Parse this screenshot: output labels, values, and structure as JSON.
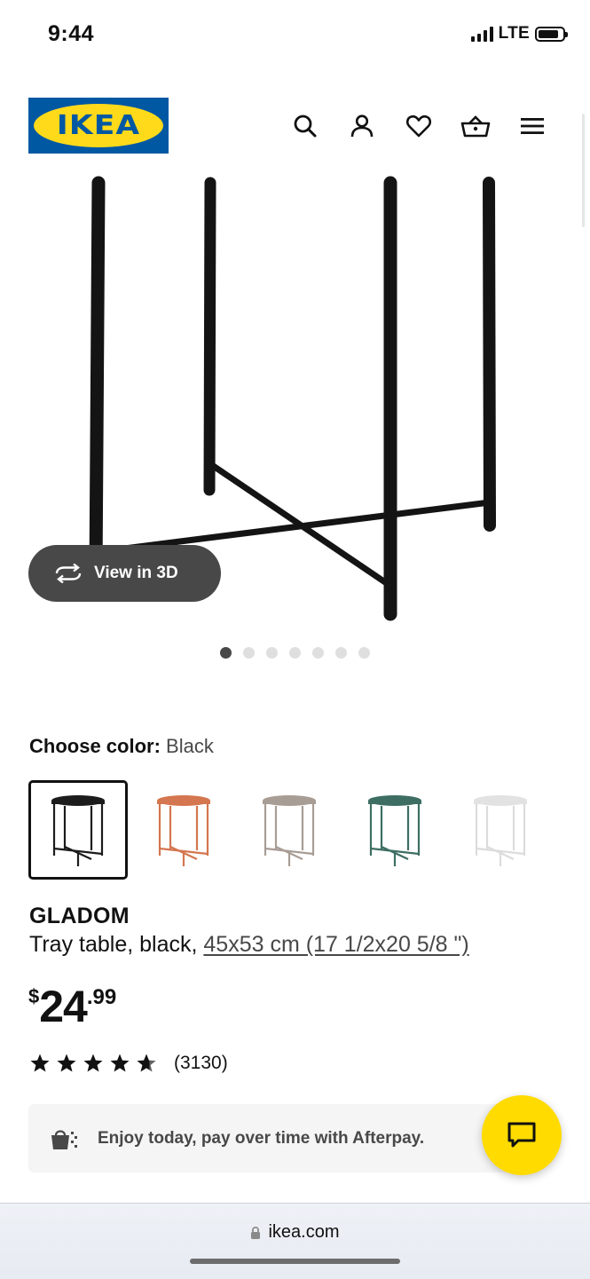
{
  "status_bar": {
    "time": "9:44",
    "network": "LTE"
  },
  "header": {
    "logo_text": "IKEA",
    "icons": [
      "search-icon",
      "account-icon",
      "heart-icon",
      "cart-icon",
      "menu-icon"
    ]
  },
  "gallery": {
    "view3d_label": "View in 3D",
    "total_images": 7,
    "active_index": 0
  },
  "color": {
    "label": "Choose color:",
    "selected": "Black",
    "swatches": [
      {
        "name": "black",
        "hex": "#1c1c1c",
        "selected": true
      },
      {
        "name": "orange",
        "hex": "#d4764f",
        "selected": false
      },
      {
        "name": "beige",
        "hex": "#a89d95",
        "selected": false
      },
      {
        "name": "green",
        "hex": "#3e6e63",
        "selected": false
      },
      {
        "name": "white",
        "hex": "#e2e2e2",
        "selected": false
      }
    ]
  },
  "product": {
    "name": "GLADOM",
    "description": "Tray table, black,",
    "dimensions": "45x53 cm (17 1/2x20 5/8 \")",
    "price_currency": "$",
    "price_integer": "24",
    "price_decimal": ".99",
    "rating_stars": 4.5,
    "rating_count": "(3130)"
  },
  "afterpay": {
    "text": "Enjoy today, pay over time with Afterpay."
  },
  "browser": {
    "url": "ikea.com"
  },
  "colors": {
    "ikea_blue": "#0058a3",
    "ikea_yellow": "#ffda1a",
    "chat_yellow": "#ffdb00",
    "dark_pill": "#484848"
  }
}
